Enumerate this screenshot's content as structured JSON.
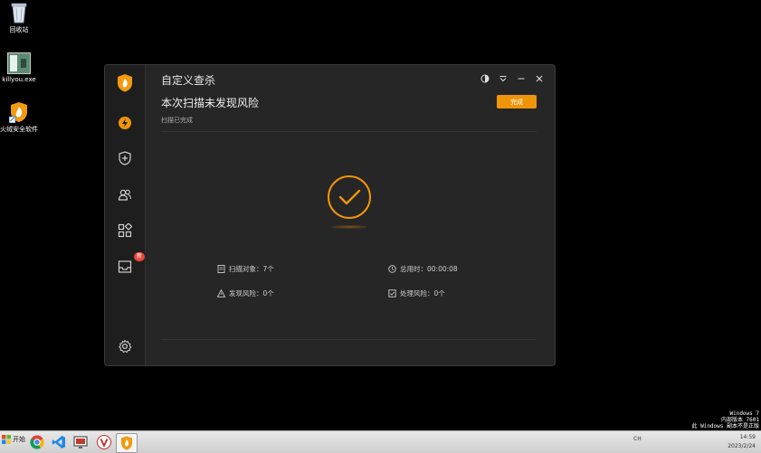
{
  "desktop": {
    "icons": [
      {
        "label": "回收站"
      },
      {
        "label": "killyou.exe"
      },
      {
        "label": "火绒安全软件"
      }
    ],
    "windows_version": {
      "line1": "Windows 7",
      "line2": "内部版本 7601",
      "line3": "此 Windows 副本不是正版"
    }
  },
  "window": {
    "title": "自定义查杀",
    "headline": "本次扫描未发现风险",
    "subline": "扫描已完成",
    "done_label": "完成",
    "badge": "新",
    "stats": {
      "scanned": "扫描对象：7个",
      "duration": "总用时：00:00:08",
      "risks_found": "发现风险：0个",
      "risks_handled": "处理风险：0个"
    },
    "colors": {
      "accent": "#f0940a",
      "background": "#262626",
      "sidebar": "#1e1e1e"
    }
  },
  "taskbar": {
    "start_label": "开始",
    "tray_text": "CH",
    "clock_time": "14:59",
    "clock_date": "2023/2/24"
  }
}
